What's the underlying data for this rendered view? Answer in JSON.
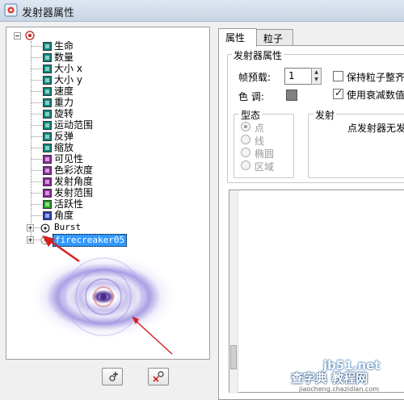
{
  "window": {
    "title": "发射器属性"
  },
  "tree": {
    "items": [
      {
        "label": "生命",
        "color": "#0e8a7c"
      },
      {
        "label": "数量",
        "color": "#0e8a7c"
      },
      {
        "label": "大小 x",
        "color": "#0e8a7c"
      },
      {
        "label": "大小 y",
        "color": "#0e8a7c"
      },
      {
        "label": "速度",
        "color": "#0e8a7c"
      },
      {
        "label": "重力",
        "color": "#0e8a7c"
      },
      {
        "label": "旋转",
        "color": "#0e8a7c"
      },
      {
        "label": "运动范围",
        "color": "#0e8a7c"
      },
      {
        "label": "反弹",
        "color": "#0e8a7c"
      },
      {
        "label": "缩放",
        "color": "#0e8a7c"
      },
      {
        "label": "可见性",
        "color": "#8e2a9e"
      },
      {
        "label": "色彩浓度",
        "color": "#8e2a9e"
      },
      {
        "label": "发射角度",
        "color": "#8e2a9e"
      },
      {
        "label": "发射范围",
        "color": "#8e2a9e"
      },
      {
        "label": "活跃性",
        "color": "#20a020"
      },
      {
        "label": "角度",
        "color": "#2a3ebd"
      }
    ],
    "nodes": [
      {
        "label": "Burst"
      },
      {
        "label": "firecreaker05"
      }
    ]
  },
  "tabs": [
    {
      "label": "属性"
    },
    {
      "label": "粒子"
    }
  ],
  "emitter_props": {
    "legend": "发射器属性",
    "frame_preload_label": "帧预载:",
    "frame_preload_value": "1",
    "hue_label": "色 调:",
    "hue_color": "#808080",
    "keep_particles_label": "保持粒子整齐",
    "keep_particles_checked": false,
    "use_decay_label": "使用衰减数值",
    "use_decay_checked": true
  },
  "shape": {
    "legend": "型态",
    "options": [
      {
        "label": "点",
        "checked": true
      },
      {
        "label": "线",
        "checked": false
      },
      {
        "label": "椭圆",
        "checked": false
      },
      {
        "label": "区域",
        "checked": false
      }
    ]
  },
  "emit": {
    "legend": "发射",
    "text": "点发射器无发"
  },
  "watermark": {
    "line1": "jb51.net",
    "line2": "查字典 教程网",
    "line3": "jiaocheng.chazidian.com"
  }
}
